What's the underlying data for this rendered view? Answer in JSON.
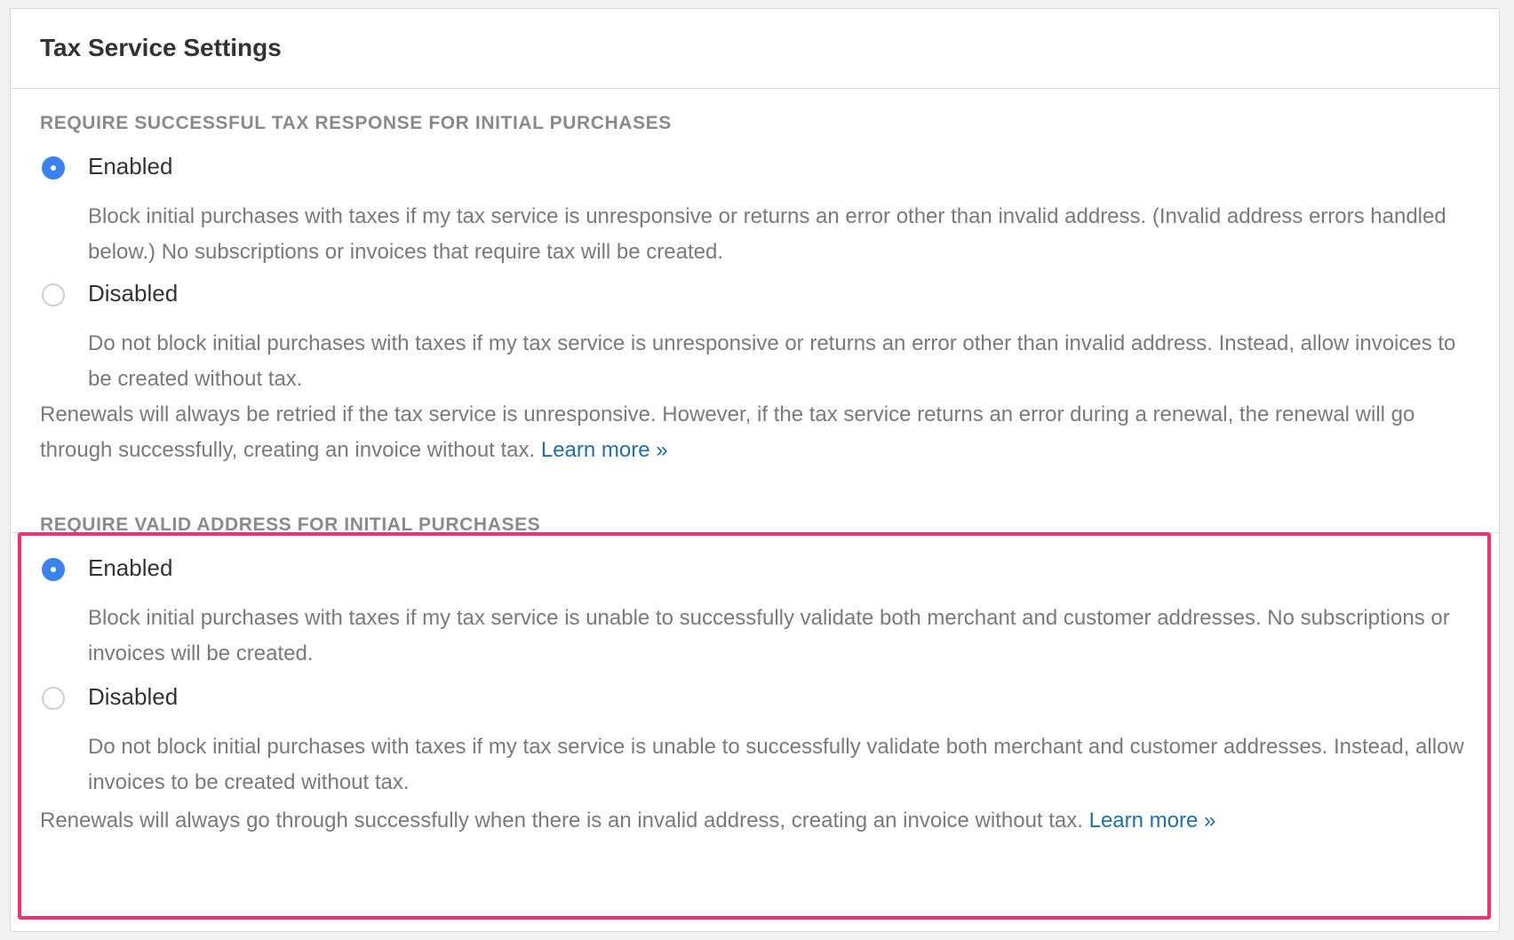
{
  "title": "Tax Service Settings",
  "sections": [
    {
      "label": "REQUIRE SUCCESSFUL TAX RESPONSE FOR INITIAL PURCHASES",
      "options": [
        {
          "label": "Enabled",
          "checked": true,
          "description": "Block initial purchases with taxes if my tax service is unresponsive or returns an error other than invalid address. (Invalid address errors handled below.) No subscriptions or invoices that require tax will be created."
        },
        {
          "label": "Disabled",
          "checked": false,
          "description": "Do not block initial purchases with taxes if my tax service is unresponsive or returns an error other than invalid address. Instead, allow invoices to be created without tax."
        }
      ],
      "note": "Renewals will always be retried if the tax service is unresponsive. However, if the tax service returns an error during a renewal, the renewal will go through successfully, creating an invoice without tax.",
      "link": "Learn more »"
    },
    {
      "label": "REQUIRE VALID ADDRESS FOR INITIAL PURCHASES",
      "options": [
        {
          "label": "Enabled",
          "checked": true,
          "description": "Block initial purchases with taxes if my tax service is unable to successfully validate both merchant and customer addresses. No subscriptions or invoices will be created."
        },
        {
          "label": "Disabled",
          "checked": false,
          "description": "Do not block initial purchases with taxes if my tax service is unable to successfully validate both merchant and customer addresses. Instead, allow invoices to be created without tax."
        }
      ],
      "note": "Renewals will always go through successfully when there is an invalid address, creating an invoice without tax.",
      "link": "Learn more »"
    }
  ],
  "colors": {
    "accent": "#3b82f1",
    "highlight_border": "#f0336d",
    "link": "#1d6fb0"
  },
  "icons": {
    "radio_checked": "radio-checked-icon",
    "radio_unchecked": "radio-unchecked-icon"
  }
}
